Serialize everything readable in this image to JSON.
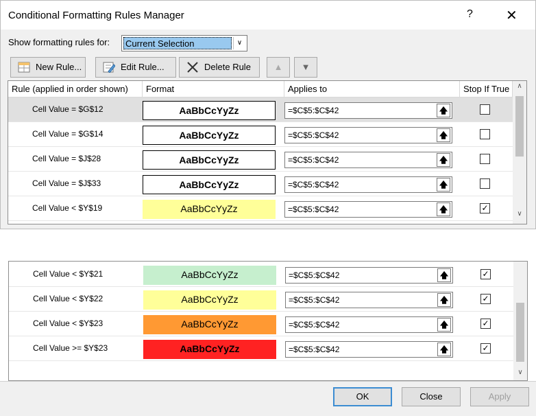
{
  "window": {
    "title": "Conditional Formatting Rules Manager",
    "help": "?",
    "close": "✕"
  },
  "show_rules": {
    "label": "Show formatting rules for:",
    "value": "Current Selection"
  },
  "toolbar": {
    "new_rule": "New Rule...",
    "edit_rule": "Edit Rule...",
    "delete_rule": "Delete Rule"
  },
  "columns": {
    "rule": "Rule (applied in order shown)",
    "format": "Format",
    "applies_to": "Applies to",
    "stop_if_true": "Stop If True"
  },
  "rows_top": [
    {
      "rule": "Cell Value = $G$12",
      "format": "AaBbCcYyZz",
      "applies_to": "=$C$5:$C$42",
      "checked": false
    },
    {
      "rule": "Cell Value = $G$14",
      "format": "AaBbCcYyZz",
      "applies_to": "=$C$5:$C$42",
      "checked": false
    },
    {
      "rule": "Cell Value = $J$28",
      "format": "AaBbCcYyZz",
      "applies_to": "=$C$5:$C$42",
      "checked": false
    },
    {
      "rule": "Cell Value = $J$33",
      "format": "AaBbCcYyZz",
      "applies_to": "=$C$5:$C$42",
      "checked": false
    },
    {
      "rule": "Cell Value < $Y$19",
      "format": "AaBbCcYyZz",
      "applies_to": "=$C$5:$C$42",
      "checked": true
    }
  ],
  "rows_bottom": [
    {
      "rule": "Cell Value < $Y$21",
      "format": "AaBbCcYyZz",
      "applies_to": "=$C$5:$C$42",
      "checked": true
    },
    {
      "rule": "Cell Value < $Y$22",
      "format": "AaBbCcYyZz",
      "applies_to": "=$C$5:$C$42",
      "checked": true
    },
    {
      "rule": "Cell Value < $Y$23",
      "format": "AaBbCcYyZz",
      "applies_to": "=$C$5:$C$42",
      "checked": true
    },
    {
      "rule": "Cell Value >= $Y$23",
      "format": "AaBbCcYyZz",
      "applies_to": "=$C$5:$C$42",
      "checked": true
    }
  ],
  "format_colors": {
    "yellow": "#ffff99",
    "light_green": "#c6efce",
    "orange": "#ff9933",
    "red": "#ff2222"
  },
  "buttons": {
    "ok": "OK",
    "close": "Close",
    "apply": "Apply"
  },
  "check_mark": "✓",
  "up_arrow": "🡅"
}
